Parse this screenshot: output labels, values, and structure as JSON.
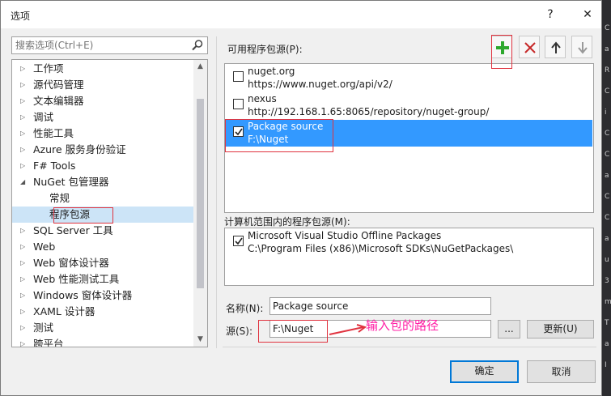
{
  "window": {
    "title": "选项",
    "help_label": "?",
    "close_label": "✕"
  },
  "search": {
    "placeholder": "搜索选项(Ctrl+E)"
  },
  "tree": {
    "items": [
      {
        "label": "工作项",
        "child": false
      },
      {
        "label": "源代码管理",
        "child": false
      },
      {
        "label": "文本编辑器",
        "child": false
      },
      {
        "label": "调试",
        "child": false
      },
      {
        "label": "性能工具",
        "child": false
      },
      {
        "label": "Azure 服务身份验证",
        "child": false
      },
      {
        "label": "F# Tools",
        "child": false
      },
      {
        "label": "NuGet 包管理器",
        "child": false,
        "expanded": true
      },
      {
        "label": "常规",
        "child": true
      },
      {
        "label": "程序包源",
        "child": true,
        "selected": true
      },
      {
        "label": "SQL Server 工具",
        "child": false
      },
      {
        "label": "Web",
        "child": false
      },
      {
        "label": "Web 窗体设计器",
        "child": false
      },
      {
        "label": "Web 性能测试工具",
        "child": false
      },
      {
        "label": "Windows 窗体设计器",
        "child": false
      },
      {
        "label": "XAML 设计器",
        "child": false
      },
      {
        "label": "测试",
        "child": false
      },
      {
        "label": "跨平台",
        "child": false
      }
    ]
  },
  "available": {
    "label": "可用程序包源(P):",
    "sources": [
      {
        "name": "nuget.org",
        "url": "https://www.nuget.org/api/v2/",
        "checked": false
      },
      {
        "name": "nexus",
        "url": "http://192.168.1.65:8065/repository/nuget-group/",
        "checked": false
      },
      {
        "name": "Package source",
        "url": "F:\\Nuget",
        "checked": true,
        "selected": true
      }
    ]
  },
  "machine": {
    "label": "计算机范围内的程序包源(M):",
    "sources": [
      {
        "name": "Microsoft Visual Studio Offline Packages",
        "url": "C:\\Program Files (x86)\\Microsoft SDKs\\NuGetPackages\\",
        "checked": true
      }
    ]
  },
  "form": {
    "name_label": "名称(N):",
    "name_value": "Package source",
    "source_label": "源(S):",
    "source_value": "F:\\Nuget",
    "browse_label": "...",
    "update_label": "更新(U)"
  },
  "footer": {
    "ok_label": "确定",
    "cancel_label": "取消"
  },
  "annotation": {
    "text": "输入包的路径",
    "color": "#ff1fa5"
  },
  "strip_chars": [
    "C",
    "a",
    "R",
    "C",
    "i",
    "C",
    "C",
    "a",
    "C",
    "C",
    "a",
    "u",
    "3",
    "m",
    "T",
    "a",
    "I"
  ],
  "colors": {
    "selection": "#3399ff",
    "tree_selection": "#cce4f7",
    "accent": "#0078d7",
    "add": "#2da82d",
    "remove": "#c62828",
    "annotation_box": "#e0333f"
  }
}
